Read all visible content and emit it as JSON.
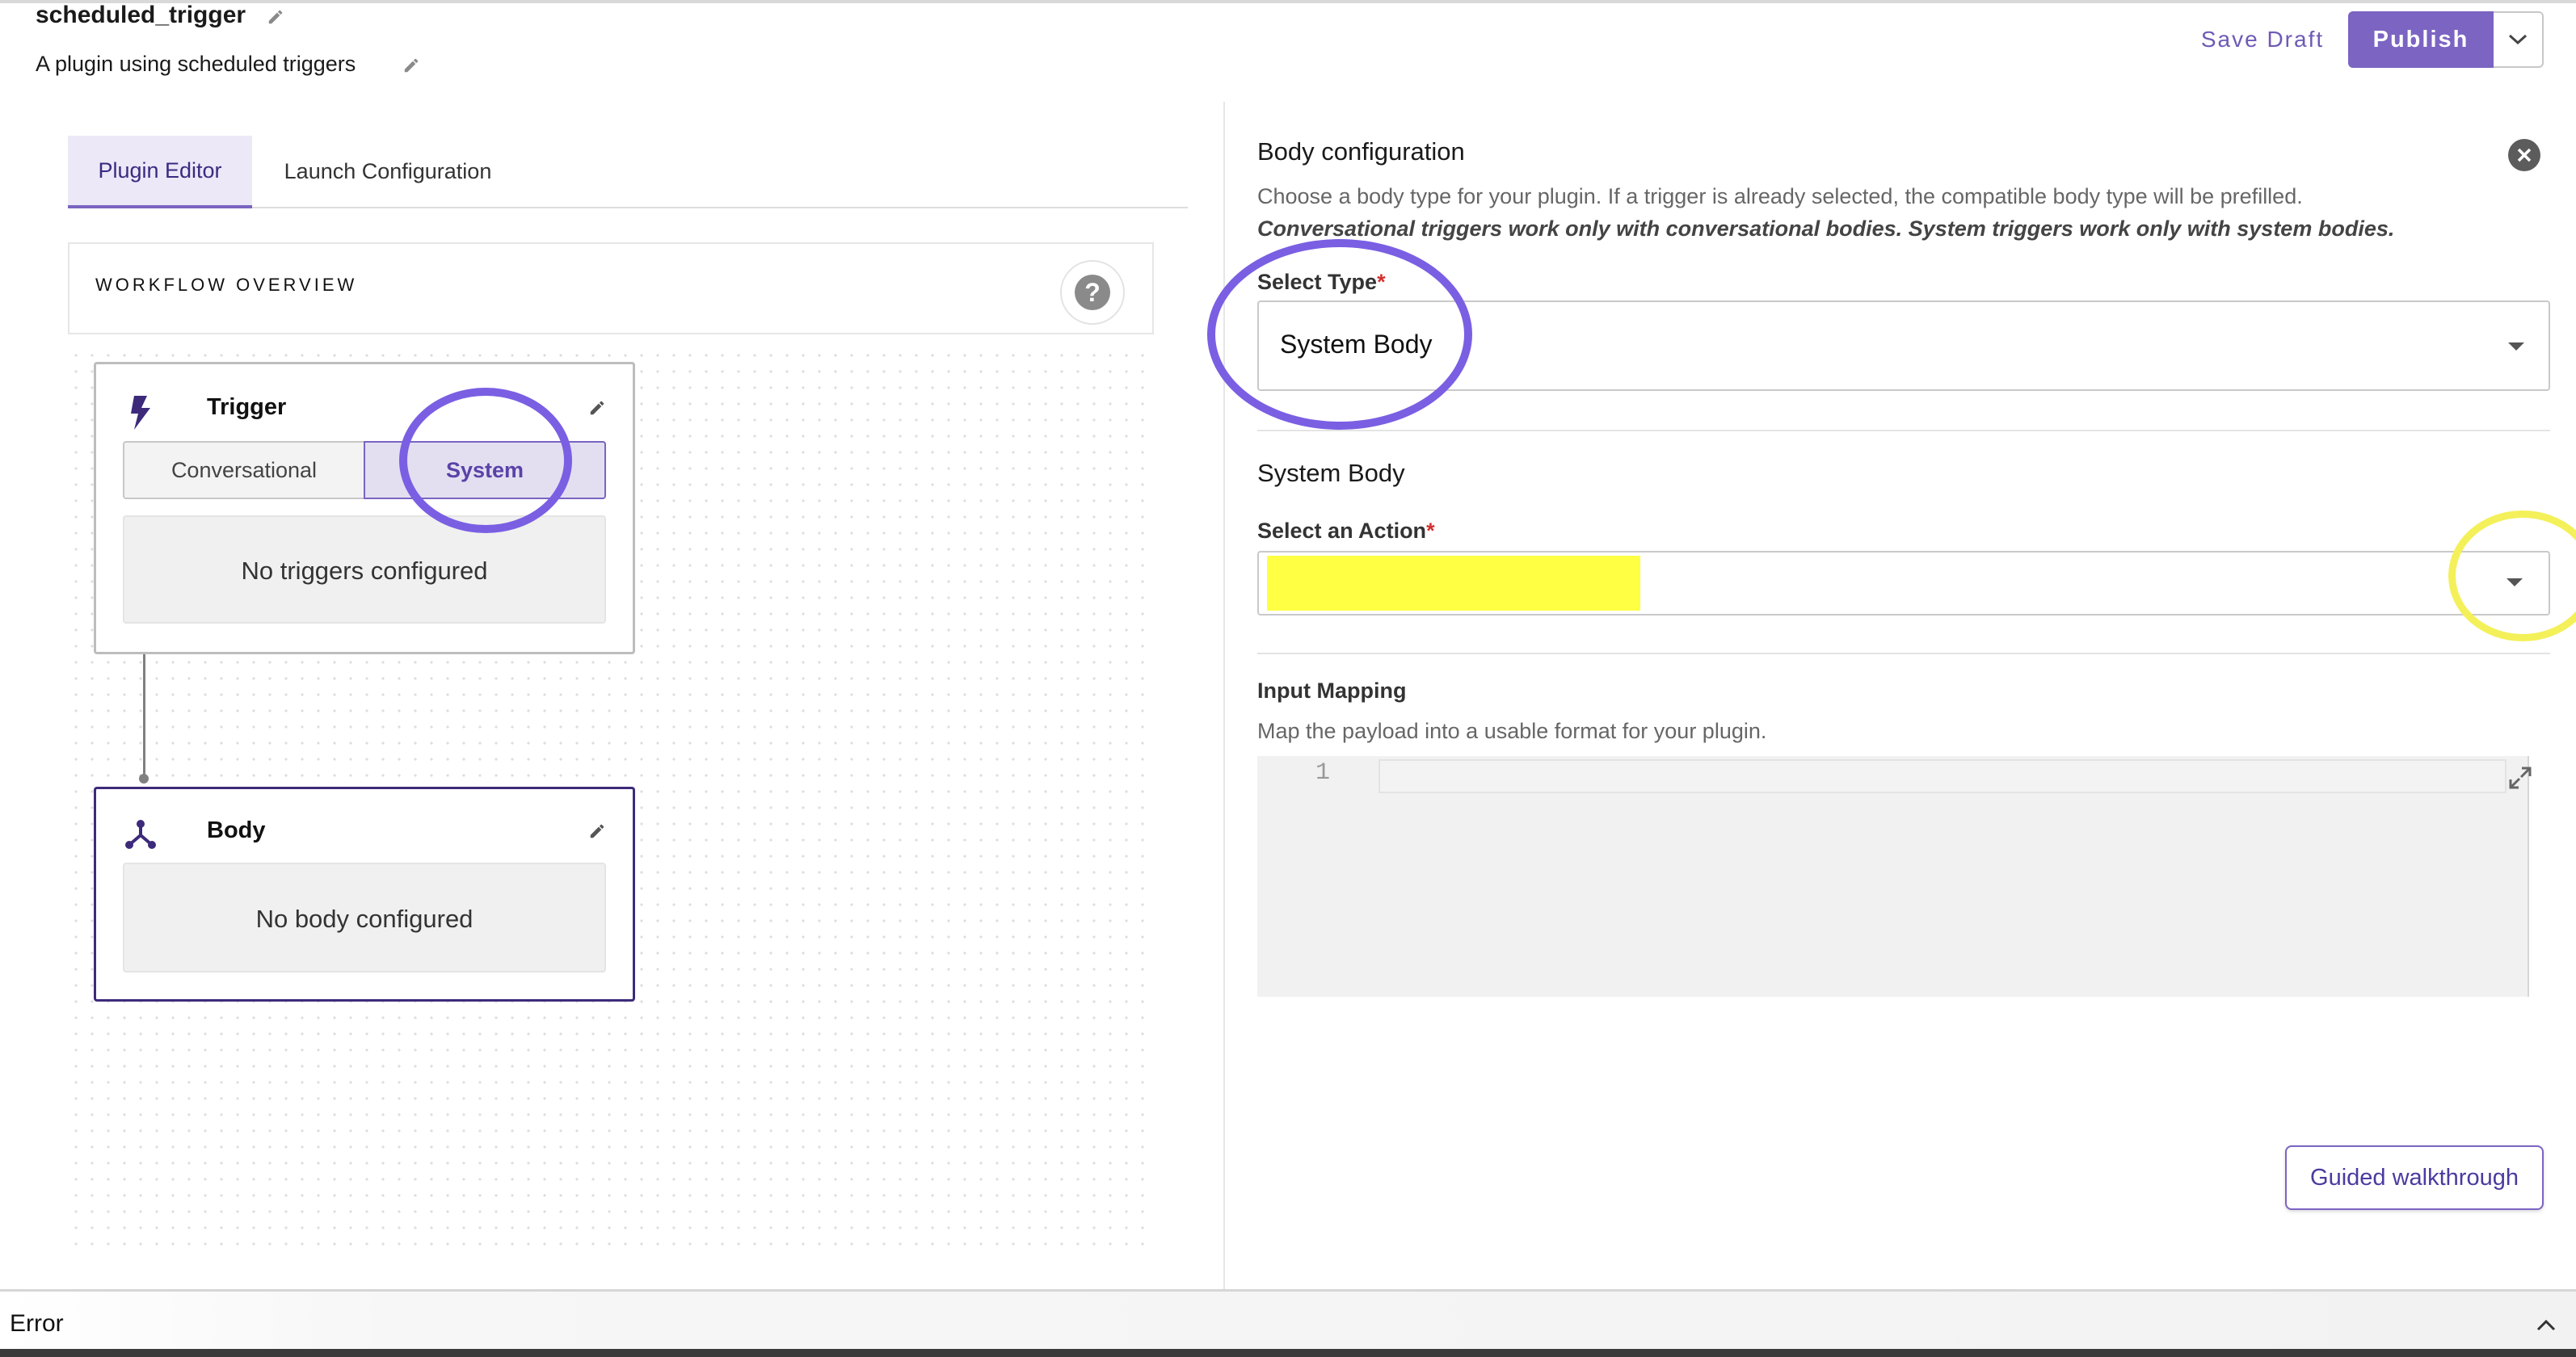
{
  "header": {
    "plugin_name": "scheduled_trigger",
    "plugin_description": "A plugin using scheduled triggers",
    "save_draft_label": "Save Draft",
    "publish_label": "Publish"
  },
  "tabs": [
    {
      "label": "Plugin Editor",
      "active": true
    },
    {
      "label": "Launch Configuration",
      "active": false
    }
  ],
  "workflow": {
    "title": "WORKFLOW OVERVIEW",
    "help_glyph": "?",
    "trigger": {
      "title": "Trigger",
      "icon": "lightning-bolt-icon",
      "segments": [
        {
          "label": "Conversational",
          "selected": false
        },
        {
          "label": "System",
          "selected": true
        }
      ],
      "empty_text": "No triggers configured"
    },
    "body": {
      "title": "Body",
      "icon": "branch-split-icon",
      "empty_text": "No body configured"
    }
  },
  "panel": {
    "title": "Body configuration",
    "help_line_1": "Choose a body type for your plugin. If a trigger is already selected, the compatible body type will be prefilled.",
    "help_line_2": "Conversational triggers work only with conversational bodies. System triggers work only with system bodies.",
    "select_type": {
      "label": "Select Type",
      "required_mark": "*",
      "value": "System Body"
    },
    "section_title": "System Body",
    "select_action": {
      "label": "Select an Action",
      "required_mark": "*",
      "value": ""
    },
    "input_mapping": {
      "label": "Input Mapping",
      "help": "Map the payload into a usable format for your plugin.",
      "line_number": "1"
    },
    "guided_label": "Guided walkthrough"
  },
  "bottom": {
    "label": "Error"
  },
  "colors": {
    "accent": "#7b64c2",
    "annotation_purple": "#7a5fe3",
    "annotation_yellow": "#f4f05a",
    "highlight_yellow": "#ffff44"
  }
}
